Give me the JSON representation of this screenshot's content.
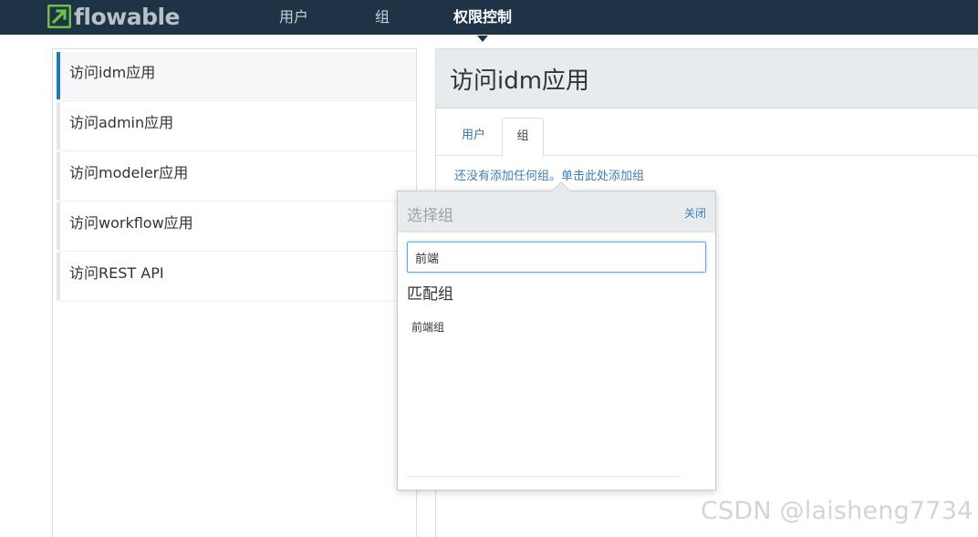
{
  "nav": {
    "logo_text": "flowable",
    "items": [
      {
        "label": "用户",
        "active": false
      },
      {
        "label": "组",
        "active": false
      },
      {
        "label": "权限控制",
        "active": true
      }
    ]
  },
  "privileges": {
    "items": [
      {
        "label": "访问idm应用",
        "selected": true
      },
      {
        "label": "访问admin应用",
        "selected": false
      },
      {
        "label": "访问modeler应用",
        "selected": false
      },
      {
        "label": "访问workflow应用",
        "selected": false
      },
      {
        "label": "访问REST API",
        "selected": false
      }
    ]
  },
  "detail": {
    "title": "访问idm应用",
    "tabs": [
      {
        "label": "用户",
        "active": false
      },
      {
        "label": "组",
        "active": true
      }
    ],
    "empty_hint": "还没有添加任何组。单击此处添加组"
  },
  "popover": {
    "title": "选择组",
    "close_label": "关闭",
    "input_value": "前端",
    "match_heading": "匹配组",
    "matches": [
      {
        "label": "前端组"
      }
    ]
  },
  "watermark": "CSDN @laisheng7734",
  "colors": {
    "navbar": "#1f3346",
    "accent": "#1e7ab8",
    "link": "#3f7fb3",
    "logo_green": "#6cc04a"
  }
}
